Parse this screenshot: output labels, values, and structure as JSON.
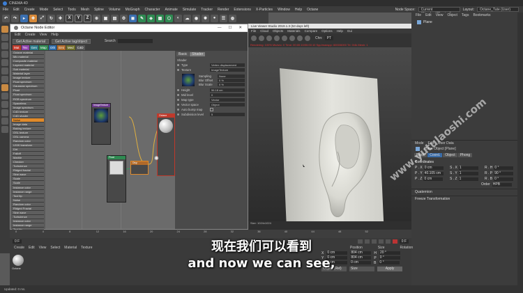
{
  "app": {
    "title": "CINEMA 4D"
  },
  "menubar": {
    "items": [
      "File",
      "Edit",
      "Create",
      "Mode",
      "Select",
      "Tools",
      "Mesh",
      "Spline",
      "Volume",
      "MoGraph",
      "Character",
      "Animate",
      "Simulate",
      "Tracker",
      "Render",
      "Extensions",
      "X-Particles",
      "Window",
      "Help",
      "Octane"
    ],
    "node_space_label": "Node Space:",
    "node_space_value": "Current (Standard/Physical)",
    "layout_label": "Layout:",
    "layout_value": "Octane_Tute (User)"
  },
  "toolbar": {
    "x": "X",
    "y": "Y",
    "z": "Z"
  },
  "node_editor": {
    "title": "Octane Node Editor",
    "menu": [
      "Edit",
      "Create",
      "View",
      "Help"
    ],
    "buttons": {
      "get_active": "Get Active material",
      "get_tag": "Get Active tag/object",
      "search": "Search"
    },
    "tabs": [
      {
        "label": "Mat",
        "color": "#c0392b"
      },
      {
        "label": "Tex",
        "color": "#8e44ad"
      },
      {
        "label": "Gen",
        "color": "#2c7a8a"
      },
      {
        "label": "Map",
        "color": "#2f8a52"
      },
      {
        "label": "Oth",
        "color": "#2c6aa8"
      },
      {
        "label": "Emi",
        "color": "#b06a2a"
      },
      {
        "label": "Med",
        "color": "#6d6d2a"
      },
      {
        "label": "C4D",
        "color": "#555555"
      }
    ],
    "node_list": [
      "Octane material",
      "Mix material",
      "Composite material",
      "Layered material",
      "Sub material",
      "Material layer",
      "Image texture",
      "Float spectrum",
      "Gaussian spectrum",
      "Float",
      "Float spectrum",
      "RGB spectrum",
      "Spaceless",
      "Image spectrum",
      "C4D texture",
      "C4D shader",
      "Noise",
      "Image data",
      "Baking texture",
      "OSL texture",
      "OSL camera",
      "Random color",
      "UVW transform",
      "Dirt",
      "Falloff",
      "Marble",
      "Checker",
      "Turbulence",
      "Ridged fractal",
      "Sine wave",
      "Scale",
      "Scale",
      "Instance color",
      "Instance range",
      "Tool tip",
      "Noise",
      "Random color",
      "Ridged Fractal",
      "Sine wave",
      "Turbulence",
      "Instance color",
      "Instance range",
      "Tool tip"
    ],
    "highlighted_item": "Noise",
    "nodes": {
      "image_texture": "ImageTexture",
      "octane_mat": "Octane",
      "disp": "Disp",
      "float_node": "Float"
    },
    "shader_tabs": [
      "Basic",
      "Shader"
    ],
    "shader_section": "Shader",
    "shader_rows": [
      {
        "label": "Type",
        "value": "Vertex displacement"
      },
      {
        "label": "Texture",
        "value": "ImageTexture"
      },
      {
        "label": "Height",
        "value": "56.18 cm"
      },
      {
        "label": "Mid level",
        "value": "0"
      },
      {
        "label": "Map type",
        "value": "Vector"
      },
      {
        "label": "Vector space",
        "value": "Object"
      },
      {
        "label": "Auto bump map",
        "value": ""
      },
      {
        "label": "Subdivision level",
        "value": "5"
      }
    ],
    "sampling": [
      {
        "label": "Sampling",
        "value": "None"
      },
      {
        "label": "Blur Offset",
        "value": "0 %"
      },
      {
        "label": "Blur Scale",
        "value": "0 %"
      }
    ]
  },
  "viewer": {
    "title": "Live Viewer Studio 2019.1.3 (53 days left)",
    "menu": [
      "File",
      "Cloud",
      "Objects",
      "Materials",
      "Compare",
      "Options",
      "Help",
      "Gui"
    ],
    "channel_label": "Chn:",
    "channel_value": "PT",
    "status_text": "Rendering: 100% Ms/sec: 0  Time: 00:00:10/00:00:10  Spp/maxspp: 6000/6000  Tri: 0/4k  Mesh: 1",
    "footer": "Size: 1024x1024"
  },
  "objects_panel": {
    "menu": [
      "File",
      "Edit",
      "View",
      "Object",
      "Tags",
      "Bookmarks"
    ],
    "object_name": "Plane"
  },
  "attributes_panel": {
    "menu": [
      "Mode",
      "Edit",
      "User Data"
    ],
    "object_label": "Plane Object [Plane]",
    "tabs": [
      "Basic",
      "Coord.",
      "Object",
      "Phong"
    ],
    "active_tab": "Coord.",
    "section": "Coordinates",
    "rows": [
      {
        "a": "P . X",
        "av": "0 cm",
        "b": "S . X",
        "bv": "1",
        "c": "R . H",
        "cv": "0 °"
      },
      {
        "a": "P . Y",
        "av": "40.105 cm",
        "b": "S . Y",
        "bv": "1",
        "c": "R . P",
        "cv": "90 °"
      },
      {
        "a": "P . Z",
        "av": "0 cm",
        "b": "S . Z",
        "bv": "1",
        "c": "R . B",
        "cv": "0 °"
      }
    ],
    "order_label": "Order",
    "order_value": "HPB",
    "quaternion": "Quaternion",
    "freeze": "Freeze Transformation"
  },
  "timeline": {
    "ticks": [
      "0",
      "4",
      "8",
      "12",
      "16",
      "20",
      "24",
      "28",
      "32",
      "36",
      "40",
      "44",
      "48",
      "52"
    ],
    "frame_start": "0 F",
    "frame_end": "0 F"
  },
  "material_manager": {
    "menu": [
      "Create",
      "Edit",
      "View",
      "Select",
      "Material",
      "Texture"
    ],
    "material_name": "Octane"
  },
  "coordinate_manager": {
    "headers": [
      "Position",
      "Size",
      "Rotation"
    ],
    "rows": [
      {
        "axis": "X",
        "pos": "0 cm",
        "size": "804 cm",
        "rot_axis": "H",
        "rot": "20 °"
      },
      {
        "axis": "Y",
        "pos": "0 cm",
        "size": "804 cm",
        "rot_axis": "P",
        "rot": "0 °"
      },
      {
        "axis": "Z",
        "pos": "0 cm",
        "size": "0 cm",
        "rot_axis": "B",
        "rot": "0 °"
      }
    ],
    "mode_value": "Object (Rel)",
    "size_mode": "Size",
    "apply_label": "Apply"
  },
  "status_bar": {
    "text": "Updated: 0 ms."
  },
  "subtitles": {
    "zh": "现在我们可以看到",
    "en": "and now we can see,"
  },
  "watermark": {
    "text": "www.yutulaoshi.com"
  }
}
